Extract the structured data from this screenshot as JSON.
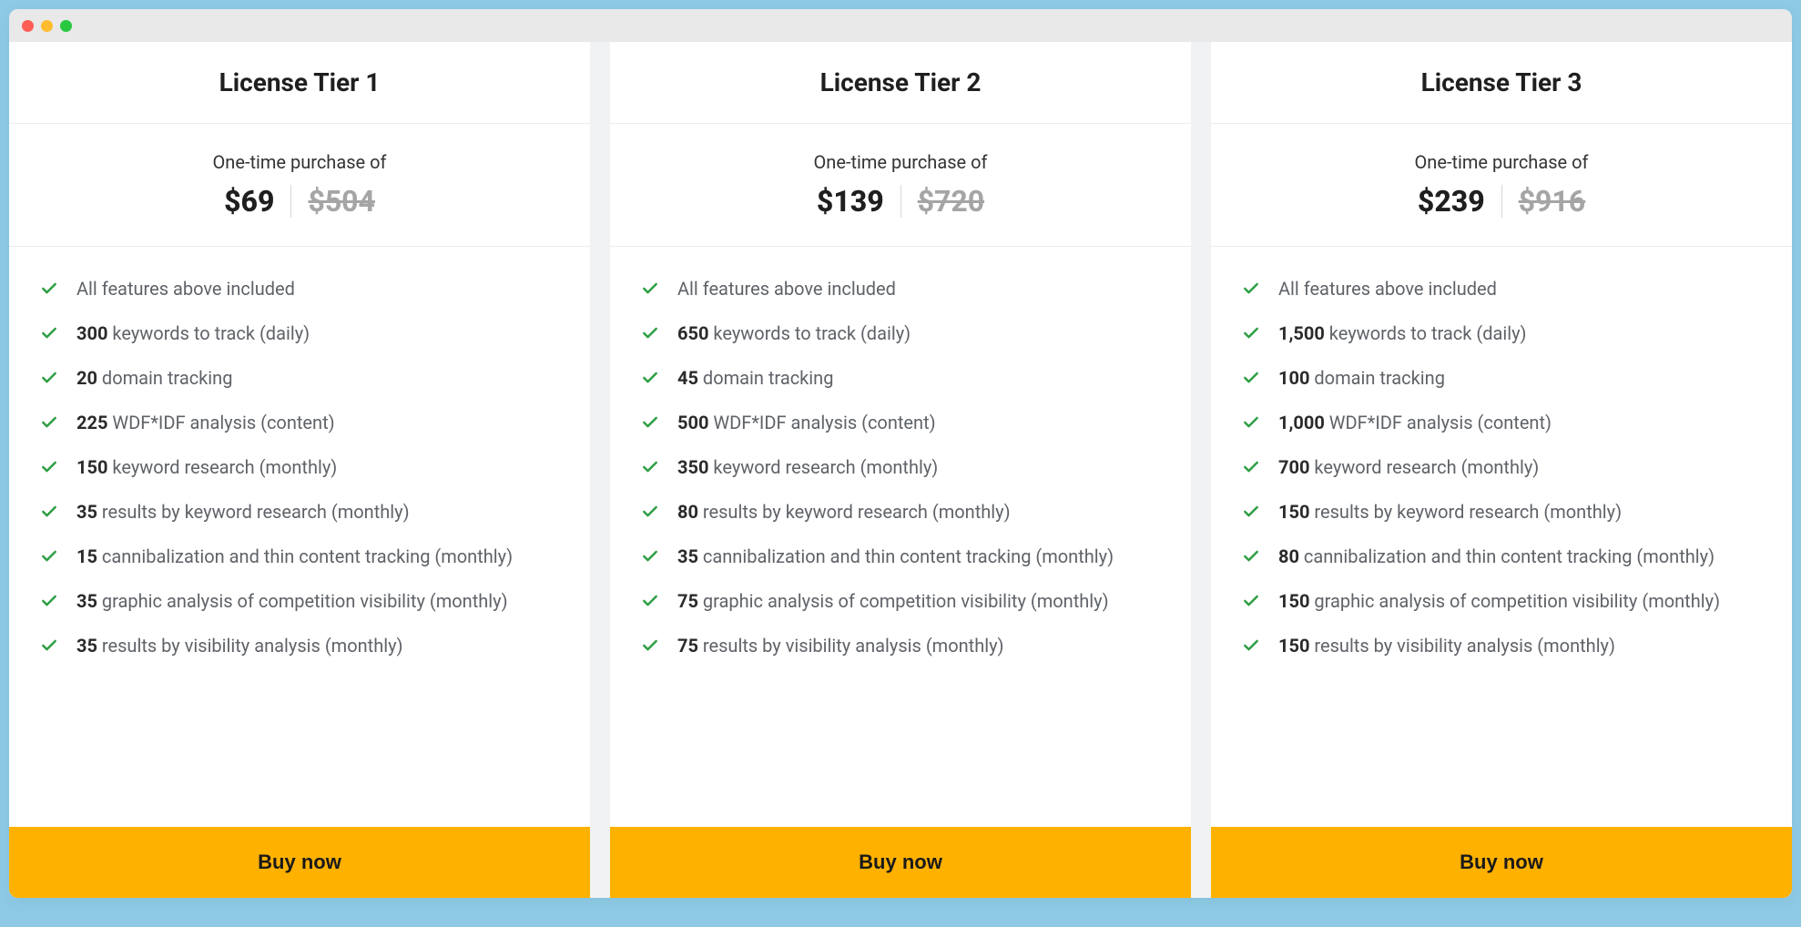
{
  "window": {
    "type": "macOS"
  },
  "common": {
    "price_lead": "One-time purchase of",
    "buy_label": "Buy now"
  },
  "tiers": [
    {
      "title": "License Tier 1",
      "price_current": "$69",
      "price_original": "$504",
      "features": [
        {
          "bold": "",
          "text": "All features above included"
        },
        {
          "bold": "300",
          "text": " keywords to track (daily)"
        },
        {
          "bold": "20",
          "text": " domain tracking"
        },
        {
          "bold": "225",
          "text": " WDF*IDF analysis (content)"
        },
        {
          "bold": "150",
          "text": " keyword research (monthly)"
        },
        {
          "bold": "35",
          "text": " results by keyword research (monthly)"
        },
        {
          "bold": "15",
          "text": " cannibalization and thin content tracking (monthly)"
        },
        {
          "bold": "35",
          "text": " graphic analysis of competition visibility (monthly)"
        },
        {
          "bold": "35",
          "text": " results by visibility analysis (monthly)"
        }
      ]
    },
    {
      "title": "License Tier 2",
      "price_current": "$139",
      "price_original": "$720",
      "features": [
        {
          "bold": "",
          "text": "All features above included"
        },
        {
          "bold": "650",
          "text": " keywords to track (daily)"
        },
        {
          "bold": "45",
          "text": " domain tracking"
        },
        {
          "bold": "500",
          "text": " WDF*IDF analysis (content)"
        },
        {
          "bold": "350",
          "text": " keyword research (monthly)"
        },
        {
          "bold": "80",
          "text": " results by keyword research (monthly)"
        },
        {
          "bold": "35",
          "text": " cannibalization and thin content tracking (monthly)"
        },
        {
          "bold": "75",
          "text": " graphic analysis of competition visibility (monthly)"
        },
        {
          "bold": "75",
          "text": " results by visibility analysis (monthly)"
        }
      ]
    },
    {
      "title": "License Tier 3",
      "price_current": "$239",
      "price_original": "$916",
      "features": [
        {
          "bold": "",
          "text": "All features above included"
        },
        {
          "bold": "1,500",
          "text": " keywords to track (daily)"
        },
        {
          "bold": "100",
          "text": " domain tracking"
        },
        {
          "bold": "1,000",
          "text": " WDF*IDF analysis (content)"
        },
        {
          "bold": "700",
          "text": " keyword research (monthly)"
        },
        {
          "bold": "150",
          "text": " results by keyword research (monthly)"
        },
        {
          "bold": "80",
          "text": " cannibalization and thin content tracking (monthly)"
        },
        {
          "bold": "150",
          "text": " graphic analysis of competition visibility (monthly)"
        },
        {
          "bold": "150",
          "text": " results by visibility analysis (monthly)"
        }
      ]
    }
  ]
}
